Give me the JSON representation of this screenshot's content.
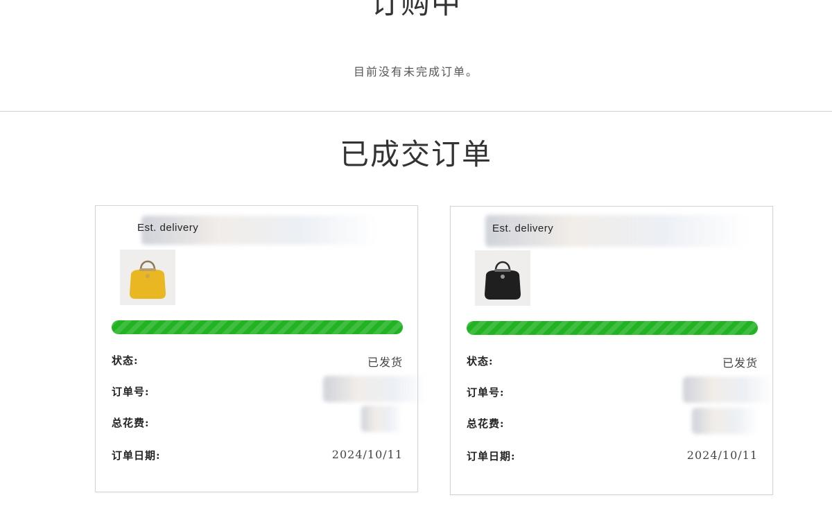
{
  "in_progress": {
    "title": "订购中",
    "empty_message": "目前没有未完成订单。"
  },
  "completed": {
    "title": "已成交订单",
    "orders": [
      {
        "est_delivery": "Est. delivery",
        "status_label": "状态:",
        "status_value": "已发货",
        "order_no_label": "订单号:",
        "total_label": "总花费:",
        "date_label": "订单日期:",
        "date_value": "2024/10/11",
        "progress": 1.0,
        "bag_color": "#e8b722"
      },
      {
        "est_delivery": "Est. delivery",
        "status_label": "状态:",
        "status_value": "已发货",
        "order_no_label": "订单号:",
        "total_label": "总花费:",
        "date_label": "订单日期:",
        "date_value": "2024/10/11",
        "progress": 1.0,
        "bag_color": "#1f1f1f"
      }
    ]
  },
  "colors": {
    "progress_green": "#22b322",
    "divider": "#cfcfcf",
    "card_border": "#d4d4d4"
  }
}
